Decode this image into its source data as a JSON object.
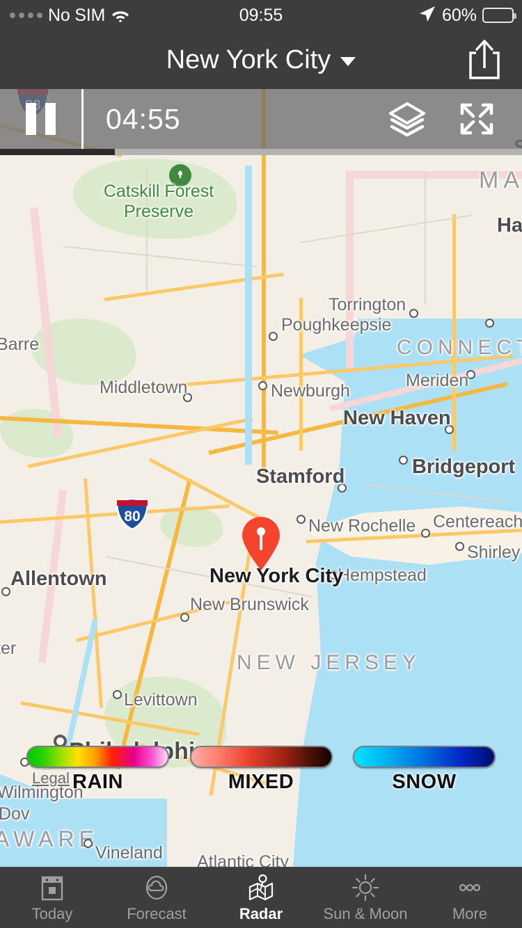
{
  "status_bar": {
    "carrier": "No SIM",
    "time": "09:55",
    "battery_percent": "60%",
    "wifi_icon": "wifi-icon",
    "location_icon": "location-arrow-icon",
    "battery_icon": "battery-icon",
    "signal_icon": "signal-dots-icon"
  },
  "header": {
    "title": "New York City",
    "dropdown_icon": "chevron-down-icon",
    "share_icon": "share-icon"
  },
  "radar_controls": {
    "pause_icon": "pause-icon",
    "timestamp": "04:55",
    "layers_icon": "layers-icon",
    "expand_icon": "expand-icon",
    "progress_percent": 22
  },
  "map": {
    "pin_label": "New York City",
    "pin_icon": "map-pin-icon",
    "legal_link": "Legal",
    "park_icon": "park-tree-icon",
    "parks": [
      {
        "name": "Catskill Forest\nPreserve",
        "line1": "Catskill Forest",
        "line2": "Preserve"
      }
    ],
    "shields": [
      {
        "number": "88"
      },
      {
        "number": "80"
      }
    ],
    "states": [
      "CONNECT",
      "NEW JERSEY",
      "MA",
      "AWARE"
    ],
    "cities": [
      "Torrington",
      "Poughkeepsie",
      "Middletown",
      "Newburgh",
      "Meriden",
      "New Haven",
      "Stamford",
      "Bridgeport",
      "New Rochelle",
      "Centereach",
      "Shirley",
      "Hempstead",
      "New Brunswick",
      "Allentown",
      "Levittown",
      "Philadelphia",
      "Wilmington",
      "Vineland",
      "Atlantic City",
      "Barre",
      "Ha",
      "S",
      "Dov",
      "ter"
    ]
  },
  "legend": {
    "items": [
      {
        "label": "RAIN",
        "gradient_class": "rain"
      },
      {
        "label": "MIXED",
        "gradient_class": "mixed"
      },
      {
        "label": "SNOW",
        "gradient_class": "snow"
      }
    ]
  },
  "tab_bar": {
    "tabs": [
      {
        "label": "Today",
        "icon": "calendar-icon",
        "active": false
      },
      {
        "label": "Forecast",
        "icon": "cloud-icon",
        "active": false
      },
      {
        "label": "Radar",
        "icon": "map-icon",
        "active": true
      },
      {
        "label": "Sun & Moon",
        "icon": "sun-icon",
        "active": false
      },
      {
        "label": "More",
        "icon": "ellipsis-icon",
        "active": false
      }
    ]
  },
  "colors": {
    "chrome": "#3d3d3d",
    "accent_pin": "#f4442e",
    "water": "#ace0f5",
    "land": "#f7f1e6",
    "road": "#fbc968"
  }
}
